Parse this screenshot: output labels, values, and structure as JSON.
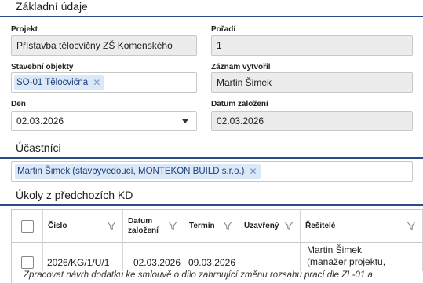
{
  "sections": {
    "basic": "Základní údaje",
    "participants": "Účastníci",
    "tasks": "Úkoly z předchozích KD"
  },
  "form": {
    "project_label": "Projekt",
    "project_value": "Přístavba tělocvičny ZŠ Komenského",
    "order_label": "Pořadí",
    "order_value": "1",
    "objects_label": "Stavební objekty",
    "objects_chip": "SO-01 Tělocvična",
    "created_by_label": "Záznam vytvořil",
    "created_by_value": "Martin Šimek",
    "day_label": "Den",
    "day_value": "02.03.2026",
    "created_date_label": "Datum založení",
    "created_date_value": "02.03.2026"
  },
  "participants": {
    "chip": "Martin Šimek (stavbyvedoucí, MONTEKON BUILD s.r.o.)"
  },
  "tasks_grid": {
    "headers": {
      "number": "Číslo",
      "created": "Datum založení",
      "deadline": "Termín",
      "closed": "Uzavřený",
      "solvers": "Řešitelé"
    },
    "row": {
      "number": "2026/KG/1/U/1",
      "created": "02.03.2026",
      "deadline": "09.03.2026",
      "closed": "",
      "solvers": "Martin Šimek (manažer projektu,",
      "description": "Zpracovat návrh dodatku ke smlouvě o dílo zahrnující změnu rozsahu prací dle ZL-01 a"
    }
  },
  "icons": {
    "chip_remove": "close-icon",
    "dropdown": "chevron-down-icon",
    "filter": "filter-icon"
  }
}
